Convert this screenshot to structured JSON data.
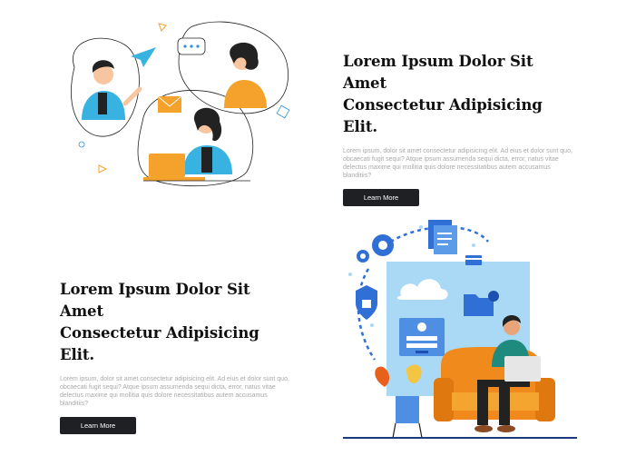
{
  "sections": [
    {
      "heading_line1": "Lorem Ipsum Dolor Sit Amet",
      "heading_line2": "Consectetur Adipisicing Elit.",
      "body": "Lorem ipsum, dolor sit amet consectetur adipisicing elit. Ad eius et dolor sunt quo, obcaecati fugit sequi? Atque ipsum assumenda sequi dicta, error, natus vitae delectus maxime qui mollitia quis dolore necessitatibus autem accusamus blanditiis?",
      "button_label": "Learn More"
    },
    {
      "heading_line1": "Lorem Ipsum Dolor Sit Amet",
      "heading_line2": "Consectetur Adipisicing Elit.",
      "body": "Lorem ipsum, dolor sit amet consectetur adipisicing elit. Ad eius et dolor sunt quo, obcaecati fugit sequi? Atque ipsum assumenda sequi dicta, error, natus vitae delectus maxime qui mollitia quis dolore necessitatibus autem accusamus blanditiis?",
      "button_label": "Learn More"
    }
  ],
  "colors": {
    "button_bg": "#1f2023",
    "accent_blue": "#2f8fd6",
    "accent_orange": "#f4a22b",
    "heading": "#111111",
    "body_text": "#a9a9a9"
  },
  "illustrations": {
    "top": "people-remote-communication-illustration",
    "bottom": "cloud-security-laptop-illustration"
  }
}
